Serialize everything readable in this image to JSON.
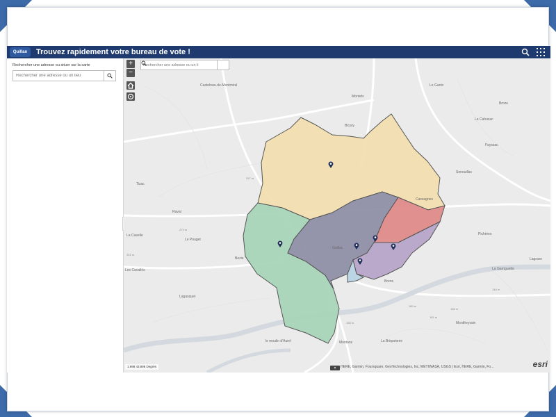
{
  "app": {
    "title": "Trouvez rapidement votre bureau de vote !",
    "logo_text": "Quillan",
    "colors": {
      "header": "#1f3a6e",
      "frame": "#3d6aa8"
    }
  },
  "header": {
    "icons": [
      "search-icon",
      "grid-icon"
    ]
  },
  "panel": {
    "label": "Rechercher une adresse ou situer sur la carte",
    "search_placeholder": "Rechercher une adresse ou un lieu"
  },
  "map": {
    "search_placeholder": "Rechercher une adresse ou un li",
    "zoom_in": "+",
    "zoom_out": "−",
    "scale_text": "1.998 43.898 Degrés",
    "attribution": "HERE, Garmin, Foursquare, GeoTechnologies, Inc, METI/NASA, USGS | Esri, HERE, Garmin, Fo...",
    "esri_logo": "esri",
    "labels": {
      "castelnau": "Castelnau-de-Montmiral",
      "montels": "Montels",
      "le_garric": "Le Garric",
      "broze": "Broze",
      "bicary": "Bicary",
      "le_cahuzac": "Le Cahuzac",
      "fayssac": "Fayssac",
      "senouillac": "Senouillac",
      "tizac": "Tizac",
      "raval": "Raval",
      "cassagnes": "Cassagnes",
      "la_caselle": "La Caselle",
      "le_pouget": "Le Pouget",
      "bezie": "Bezie",
      "lagrave": "Lagrave",
      "la_garriguette": "La Garriguette",
      "picheres": "Pichères",
      "brens": "Brens",
      "les_cavalles": "Les Cavallès",
      "montfreyssin": "Montfreyssin",
      "le_moulin": "le moulin d'Aurel",
      "montans": "Montans",
      "la_briqueterie": "La Briqueterie",
      "gaillac": "Gaillac",
      "lagasquet": "Lagasquet",
      "elev1": "257 m",
      "elev2": "279 m",
      "elev3": "251 m",
      "elev4": "185 m",
      "elev5": "181 m",
      "elev6": "144 m",
      "elev7": "158 m",
      "elev8": "158 m"
    }
  }
}
